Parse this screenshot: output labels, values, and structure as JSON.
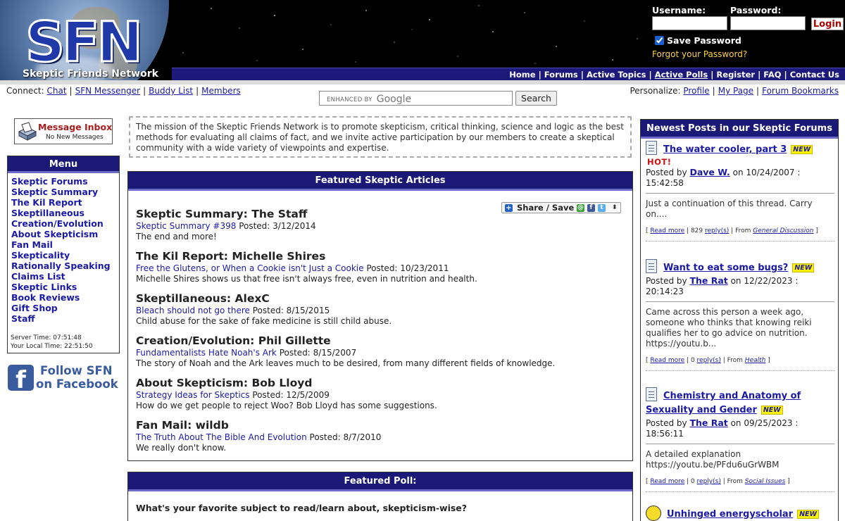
{
  "site": {
    "logo_letters": "SFN",
    "logo_subtitle": "Skeptic Friends Network"
  },
  "login": {
    "username_label": "Username:",
    "password_label": "Password:",
    "login_button": "Login",
    "save_password_label": "Save Password",
    "save_password_checked": true,
    "forgot_link": "Forgot your Password?"
  },
  "nav": {
    "items": [
      {
        "label": "Home"
      },
      {
        "label": "Forums"
      },
      {
        "label": "Active Topics"
      },
      {
        "label": "Active Polls"
      },
      {
        "label": "Register"
      },
      {
        "label": "FAQ"
      },
      {
        "label": "Contact Us"
      }
    ]
  },
  "connect": {
    "label": "Connect:",
    "links": [
      "Chat",
      "SFN Messenger",
      "Buddy List",
      "Members"
    ]
  },
  "search": {
    "placeholder_prefix": "ENHANCED BY",
    "placeholder_brand": "Google",
    "button": "Search"
  },
  "personalize": {
    "label": "Personalize:",
    "links": [
      "Profile",
      "My Page",
      "Forum Bookmarks"
    ]
  },
  "inbox": {
    "title": "Message Inbox",
    "status": "No New Messages"
  },
  "menu": {
    "title": "Menu",
    "items": [
      "Skeptic Forums",
      "Skeptic Summary",
      "The Kil Report",
      "Skeptillaneous",
      "Creation/Evolution",
      "About Skepticism",
      "Fan Mail",
      "Skepticality",
      "Rationally Speaking",
      "Claims List",
      "Skeptic Links",
      "Book Reviews",
      "Gift Shop",
      "Staff"
    ],
    "server_time": "Server Time: 07:51:48",
    "local_time": "Your Local Time: 22:51:50"
  },
  "facebook": {
    "line1": "Follow SFN",
    "line2": "on Facebook"
  },
  "mission": "The mission of the Skeptic Friends Network is to promote skepticism, critical thinking, science and logic as the best methods for evaluating all claims of fact, and we invite active participation by our members to create a skeptical community with a wide variety of viewpoints and expertise.",
  "featured": {
    "title": "Featured Skeptic Articles",
    "share_label": "Share / Save",
    "articles": [
      {
        "heading": "Skeptic Summary: The Staff",
        "link": "Skeptic Summary #398",
        "posted": "Posted: 3/12/2014",
        "desc": "The end and more!"
      },
      {
        "heading": "The Kil Report: Michelle Shires",
        "link": "Free the Glutens, or When a Cookie isn't Just a Cookie",
        "posted": "Posted: 10/23/2011",
        "desc": "Michelle Shires shows us that free isn't always free, even in nutrition and health."
      },
      {
        "heading": "Skeptillaneous: AlexC",
        "link": "Bleach should not go there",
        "posted": "Posted: 8/15/2015",
        "desc": "Child abuse for the sake of fake medicine is still child abuse."
      },
      {
        "heading": "Creation/Evolution: Phil Gillette",
        "link": "Fundamentalists Hate Noah's Ark",
        "posted": "Posted: 8/15/2007",
        "desc": "The story of Noah and the Ark leaves much to be desired, from many different fields of knowledge."
      },
      {
        "heading": "About Skepticism: Bob Lloyd",
        "link": "Strategy Ideas for Skeptics",
        "posted": "Posted: 12/5/2009",
        "desc": "How do we get people to reject Woo? Bob Lloyd has some suggestions."
      },
      {
        "heading": "Fan Mail: wildb",
        "link": "The Truth About The Bible And Evolution",
        "posted": "Posted: 8/7/2010",
        "desc": "We really don't know."
      }
    ]
  },
  "poll": {
    "title": "Featured Poll:",
    "question": "What's your favorite subject to read/learn about, skepticism-wise?"
  },
  "newest": {
    "title": "Newest Posts in our Skeptic Forums",
    "new_badge": "NEW",
    "hot_badge": "HOT!",
    "read_more": "Read more",
    "posted_by": "Posted by",
    "posts": [
      {
        "title": "The water cooler, part 3",
        "hot": true,
        "author": "Dave W.",
        "date": "on 10/24/2007 : 15:42:58",
        "excerpt": "Just a continuation of this thread. Carry on....",
        "replies": "829",
        "replies_label": "reply(s)",
        "from_label": "From",
        "forum": "General Discussion"
      },
      {
        "title": "Want to eat some bugs?",
        "hot": false,
        "author": "The Rat",
        "date": "on 12/22/2023 : 20:14:23",
        "excerpt": "Came across this person a week ago, someone who thinks that knowing reiki qualifies her to go advice on nutrition. https://youtu.b...",
        "replies": "0",
        "replies_label": "reply(s)",
        "from_label": "From",
        "forum": "Health"
      },
      {
        "title": "Chemistry and Anatomy of Sexuality and Gender",
        "hot": false,
        "author": "The Rat",
        "date": "on 09/25/2023 : 18:56:11",
        "excerpt": "A detailed explanation https://youtu.be/PFdu6uGrWBM",
        "replies": "0",
        "replies_label": "reply(s)",
        "from_label": "From",
        "forum": "Social Issues"
      },
      {
        "title": "Unhinged energyscholar",
        "hot": false
      }
    ]
  },
  "colors": {
    "panel_header": "#1a1978",
    "link": "#1a1aa6",
    "hot": "#d01010",
    "new_badge_bg": "#fff200",
    "forgot_link": "#ffd23e"
  }
}
